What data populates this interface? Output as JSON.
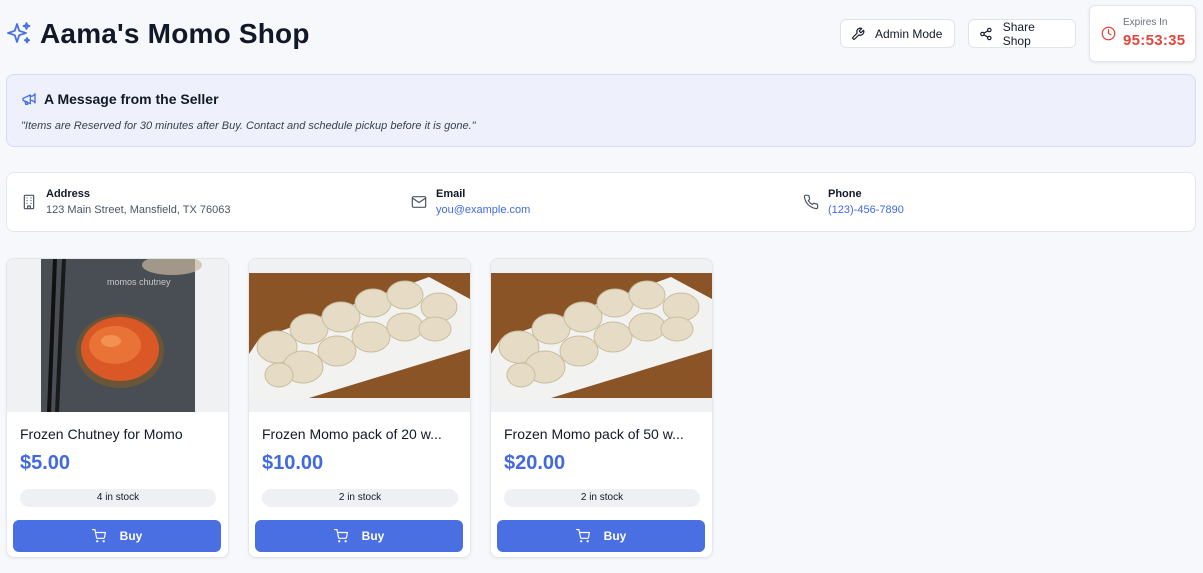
{
  "header": {
    "title": "Aama's Momo Shop",
    "admin_label": "Admin Mode",
    "share_label": "Share Shop",
    "expires_label": "Expires In",
    "expires_time": "95:53:35"
  },
  "message": {
    "title": "A Message from the Seller",
    "text": "\"Items are Reserved for 30 minutes after Buy. Contact and schedule pickup before it is gone.\""
  },
  "contact": {
    "address_label": "Address",
    "address_value": "123 Main Street, Mansfield, TX 76063",
    "email_label": "Email",
    "email_value": "you@example.com",
    "phone_label": "Phone",
    "phone_value": "(123)-456-7890"
  },
  "products": [
    {
      "name": "Frozen Chutney for Momo",
      "price": "$5.00",
      "stock": "4 in stock",
      "buy_label": "Buy",
      "image_caption": "momos chutney"
    },
    {
      "name": "Frozen Momo pack of 20 w...",
      "price": "$10.00",
      "stock": "2 in stock",
      "buy_label": "Buy"
    },
    {
      "name": "Frozen Momo pack of 50 w...",
      "price": "$20.00",
      "stock": "2 in stock",
      "buy_label": "Buy"
    }
  ],
  "colors": {
    "accent": "#4a6fe3",
    "link": "#4169e1",
    "timer": "#e0473c"
  }
}
